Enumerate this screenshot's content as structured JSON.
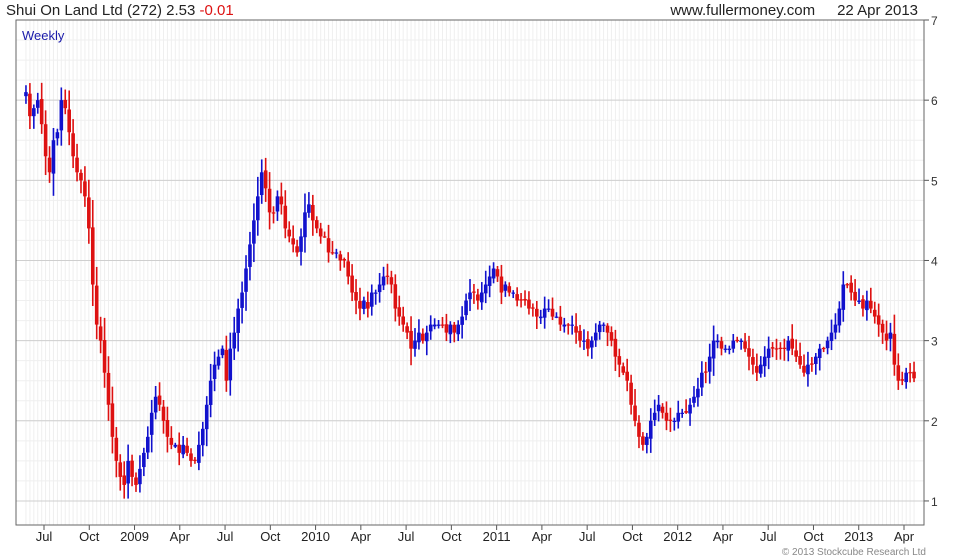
{
  "header": {
    "name": "Shui On Land Ltd",
    "code": "(272)",
    "price": "2.53",
    "change": "-0.01",
    "site": "www.fullermoney.com",
    "date": "22 Apr 2013"
  },
  "chart_data": {
    "type": "candlestick",
    "period_label": "Weekly",
    "ylim": [
      0.7,
      7
    ],
    "y_ticks": [
      1,
      2,
      3,
      4,
      5,
      6,
      7
    ],
    "x_tick_labels": [
      "Jul",
      "Oct",
      "2009",
      "Apr",
      "Jul",
      "Oct",
      "2010",
      "Apr",
      "Jul",
      "Oct",
      "2011",
      "Apr",
      "Jul",
      "Oct",
      "2012",
      "Apr",
      "Jul",
      "Oct",
      "2013",
      "Apr"
    ],
    "up_color": "#1111cc",
    "down_color": "#dd1111",
    "grid": true,
    "approx_weekly_closes": [
      6.1,
      5.8,
      5.9,
      6.0,
      5.7,
      5.3,
      5.1,
      5.5,
      5.6,
      6.0,
      5.9,
      5.6,
      5.3,
      5.1,
      5.0,
      4.8,
      4.4,
      3.7,
      3.2,
      3.0,
      2.6,
      2.2,
      1.8,
      1.5,
      1.3,
      1.2,
      1.5,
      1.3,
      1.2,
      1.4,
      1.6,
      1.8,
      2.1,
      2.3,
      2.2,
      2.0,
      1.8,
      1.7,
      1.7,
      1.6,
      1.7,
      1.6,
      1.5,
      1.5,
      1.7,
      1.9,
      2.2,
      2.5,
      2.7,
      2.8,
      2.9,
      2.5,
      2.9,
      3.1,
      3.4,
      3.6,
      3.9,
      4.2,
      4.5,
      4.8,
      5.1,
      4.9,
      4.6,
      4.6,
      4.8,
      4.7,
      4.4,
      4.3,
      4.2,
      4.1,
      4.3,
      4.6,
      4.7,
      4.5,
      4.4,
      4.3,
      4.3,
      4.1,
      4.1,
      4.1,
      4.0,
      4.0,
      3.8,
      3.6,
      3.5,
      3.4,
      3.5,
      3.4,
      3.6,
      3.6,
      3.7,
      3.8,
      3.8,
      3.7,
      3.4,
      3.3,
      3.2,
      3.1,
      2.9,
      3.0,
      3.1,
      3.0,
      3.1,
      3.2,
      3.2,
      3.2,
      3.2,
      3.1,
      3.2,
      3.1,
      3.2,
      3.3,
      3.5,
      3.6,
      3.6,
      3.5,
      3.6,
      3.7,
      3.8,
      3.9,
      3.8,
      3.6,
      3.7,
      3.6,
      3.6,
      3.5,
      3.5,
      3.5,
      3.4,
      3.4,
      3.3,
      3.3,
      3.4,
      3.4,
      3.3,
      3.3,
      3.2,
      3.2,
      3.2,
      3.2,
      3.1,
      3.0,
      3.0,
      2.9,
      3.0,
      3.1,
      3.2,
      3.2,
      3.1,
      3.0,
      2.8,
      2.7,
      2.6,
      2.5,
      2.2,
      2.0,
      1.8,
      1.7,
      1.8,
      2.0,
      2.1,
      2.2,
      2.1,
      2.0,
      2.0,
      2.0,
      2.1,
      2.1,
      2.1,
      2.2,
      2.3,
      2.4,
      2.6,
      2.6,
      2.8,
      3.0,
      3.0,
      2.9,
      2.9,
      2.9,
      3.0,
      3.0,
      3.0,
      2.9,
      2.8,
      2.7,
      2.6,
      2.7,
      2.8,
      2.9,
      2.9,
      2.9,
      2.9,
      2.9,
      3.0,
      2.9,
      2.8,
      2.7,
      2.6,
      2.7,
      2.7,
      2.8,
      2.9,
      2.9,
      3.0,
      3.1,
      3.2,
      3.4,
      3.7,
      3.7,
      3.6,
      3.5,
      3.5,
      3.4,
      3.5,
      3.4,
      3.3,
      3.2,
      3.1,
      3.0,
      3.1,
      2.7,
      2.5,
      2.5,
      2.6,
      2.6,
      2.53
    ]
  },
  "footer": {
    "copyright": "© 2013 Stockcube Research Ltd"
  }
}
